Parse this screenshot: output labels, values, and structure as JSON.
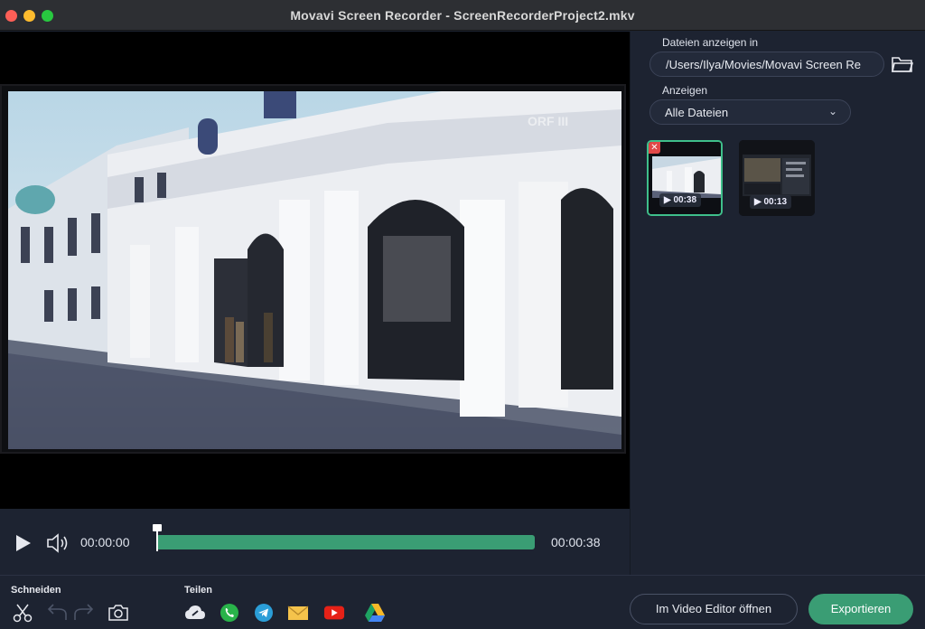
{
  "window": {
    "title": "Movavi Screen Recorder - ScreenRecorderProject2.mkv"
  },
  "sidebar": {
    "folder_label": "Dateien anzeigen in",
    "folder_path": "/Users/Ilya/Movies/Movavi Screen Re",
    "filter_label": "Anzeigen",
    "filter_value": "Alle Dateien",
    "thumbnails": [
      {
        "duration": "00:38",
        "selected": true
      },
      {
        "duration": "00:13",
        "selected": false
      }
    ]
  },
  "player": {
    "current_time": "00:00:00",
    "total_time": "00:00:38",
    "progress": 0.0,
    "video_overlay": "ORF III"
  },
  "toolbar": {
    "cut_label": "Schneiden",
    "share_label": "Teilen",
    "open_editor_label": "Im Video Editor öffnen",
    "export_label": "Exportieren"
  },
  "colors": {
    "accent": "#3a9d74",
    "background": "#1d2331",
    "delete": "#e04848"
  }
}
